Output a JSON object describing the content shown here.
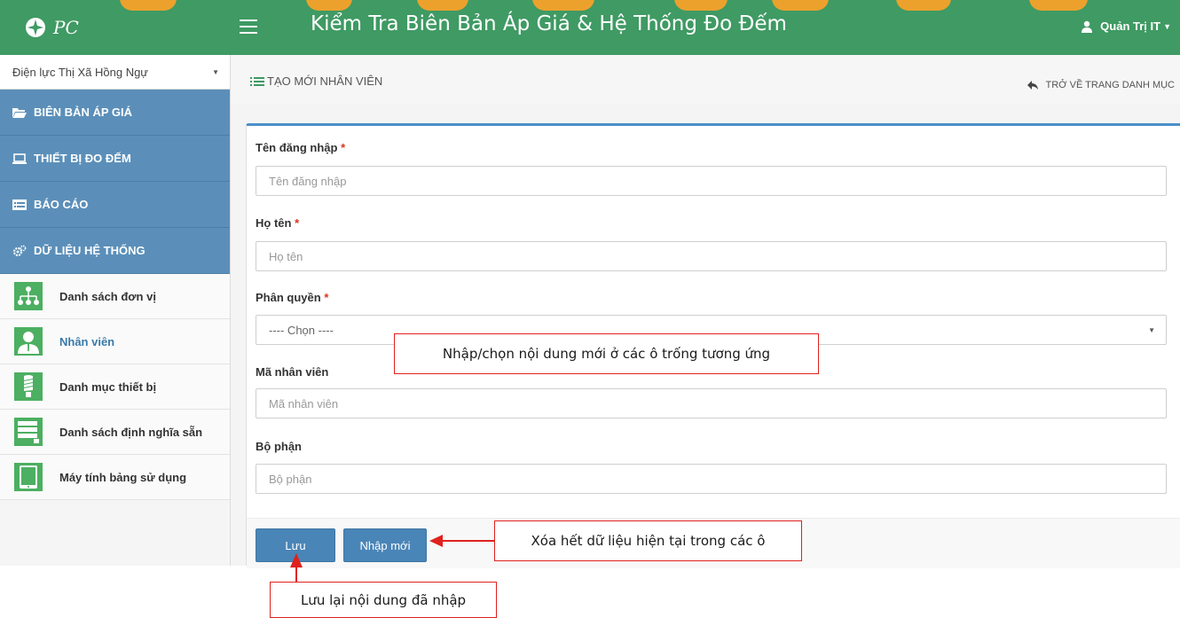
{
  "header": {
    "brand": "PC",
    "title": "Kiểm Tra Biên Bản Áp Giá & Hệ Thống Đo Đếm",
    "user": "Quản Trị IT"
  },
  "sidebar": {
    "unit_select": "Điện lực Thị Xã Hồng Ngự",
    "menu": [
      {
        "label": "BIÊN BẢN ÁP GIÁ",
        "icon": "folder-open-icon"
      },
      {
        "label": "THIẾT BỊ ĐO ĐẾM",
        "icon": "laptop-icon"
      },
      {
        "label": "BÁO CÁO",
        "icon": "list-alt-icon"
      },
      {
        "label": "DỮ LIỆU HỆ THỐNG",
        "icon": "cogs-icon"
      }
    ],
    "submenu": [
      {
        "label": "Danh sách đơn vị",
        "icon": "org-chart-icon"
      },
      {
        "label": "Nhân viên",
        "icon": "user-icon",
        "active": true
      },
      {
        "label": "Danh mục thiết bị",
        "icon": "bulb-icon"
      },
      {
        "label": "Danh sách định nghĩa sẵn",
        "icon": "document-list-icon"
      },
      {
        "label": "Máy tính bảng sử dụng",
        "icon": "tablet-icon"
      }
    ]
  },
  "page": {
    "title": "TẠO MỚI NHÂN VIÊN",
    "back_link": "TRỞ VỀ TRANG DANH MỤC"
  },
  "form": {
    "username": {
      "label": "Tên đăng nhập",
      "placeholder": "Tên đăng nhập",
      "required": true
    },
    "fullname": {
      "label": "Họ tên",
      "placeholder": "Họ tên",
      "required": true
    },
    "role": {
      "label": "Phân quyền",
      "selected": "---- Chọn ----",
      "required": true
    },
    "employee_code": {
      "label": "Mã nhân viên",
      "placeholder": "Mã nhân viên"
    },
    "department": {
      "label": "Bộ phận",
      "placeholder": "Bộ phận"
    },
    "required_mark": "*",
    "save_button": "Lưu",
    "reset_button": "Nhập mới"
  },
  "annotations": {
    "fill_fields": "Nhập/chọn nội dung mới ở các ô trống tương ứng",
    "clear_fields": "Xóa hết dữ liệu hiện tại trong các ô",
    "save_content": "Lưu lại nội dung đã nhập"
  },
  "colors": {
    "header_bg": "#3f9a63",
    "menu_bg": "#5b8fb9",
    "button_bg": "#4a85b7",
    "card_accent": "#4b8fc9",
    "required": "#d9341d",
    "callout_border": "#e0211d",
    "watermark": "#f5a12a"
  }
}
